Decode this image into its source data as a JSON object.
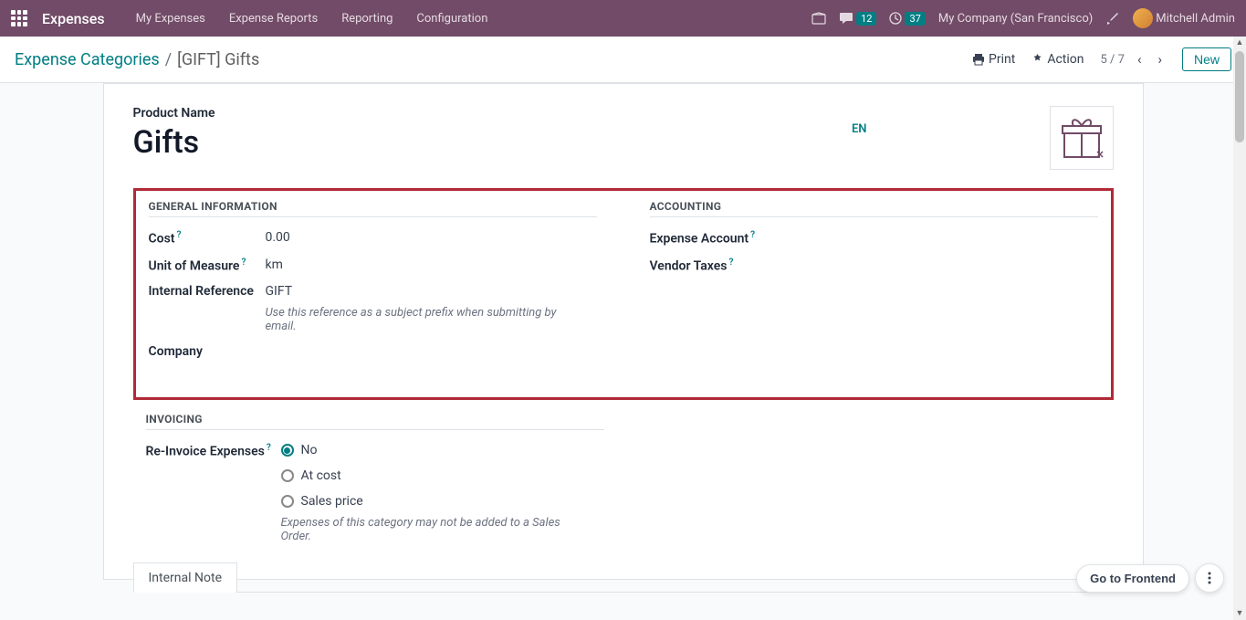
{
  "navbar": {
    "brand": "Expenses",
    "items": [
      "My Expenses",
      "Expense Reports",
      "Reporting",
      "Configuration"
    ],
    "messages_count": "12",
    "activities_count": "37",
    "company": "My Company (San Francisco)",
    "user": "Mitchell Admin"
  },
  "breadcrumb": {
    "parent": "Expense Categories",
    "current": "[GIFT] Gifts"
  },
  "actions": {
    "print": "Print",
    "action": "Action",
    "new": "New"
  },
  "pager": {
    "position": "5 / 7"
  },
  "form": {
    "product_name_label": "Product Name",
    "product_name": "Gifts",
    "lang": "EN",
    "sections": {
      "general": {
        "title": "GENERAL INFORMATION",
        "cost_label": "Cost",
        "cost_value": "0.00",
        "uom_label": "Unit of Measure",
        "uom_value": "km",
        "ref_label": "Internal Reference",
        "ref_value": "GIFT",
        "ref_help": "Use this reference as a subject prefix when submitting by email.",
        "company_label": "Company"
      },
      "accounting": {
        "title": "ACCOUNTING",
        "expense_account_label": "Expense Account",
        "vendor_taxes_label": "Vendor Taxes"
      },
      "invoicing": {
        "title": "INVOICING",
        "reinvoice_label": "Re-Invoice Expenses",
        "options": {
          "no": "No",
          "at_cost": "At cost",
          "sales_price": "Sales price"
        },
        "help": "Expenses of this category may not be added to a Sales Order."
      }
    },
    "tabs": {
      "internal_note": "Internal Note"
    }
  },
  "floating": {
    "frontend": "Go to Frontend"
  }
}
